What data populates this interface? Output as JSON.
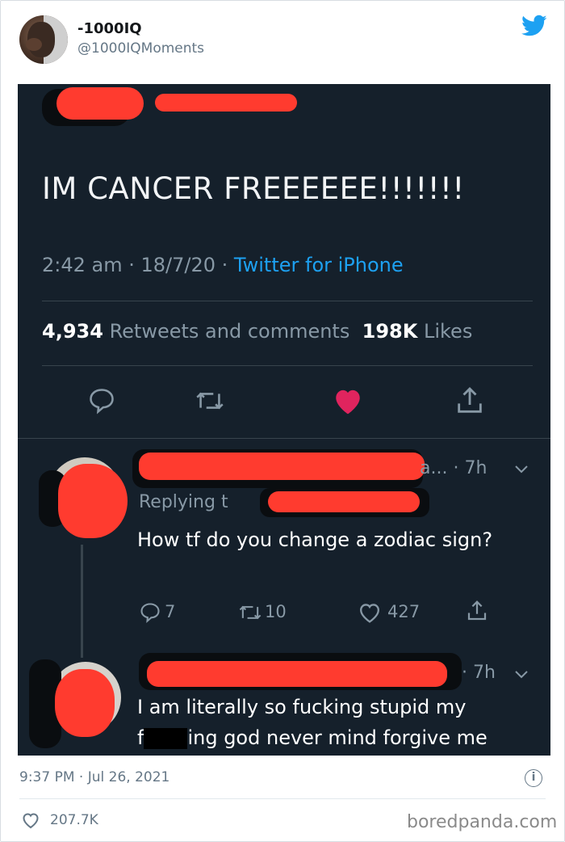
{
  "colors": {
    "twitter_blue": "#1da1f2",
    "like_pink": "#e0245e",
    "redaction": "#ff3b2f",
    "dark_bg": "#15202b"
  },
  "author": {
    "name": "-1000IQ",
    "handle": "@1000IQMoments"
  },
  "screenshot": {
    "main_tweet": {
      "text": "IM CANCER FREEEEEE!!!!!!!",
      "time": "2:42 am",
      "date": "18/7/20",
      "source": "Twitter for iPhone",
      "retweets": "4,934",
      "retweets_label": "Retweets and comments",
      "likes": "198K",
      "likes_label": "Likes",
      "actions": [
        "reply-icon",
        "retweet-icon",
        "like-icon-filled",
        "share-icon"
      ]
    },
    "reply1": {
      "time_suffix": "a... · 7h",
      "replying_to": "Replying t",
      "text": "How tf do you change a zodiac sign?",
      "replies": "7",
      "retweets": "10",
      "likes": "427"
    },
    "reply2": {
      "time_suffix": "· 7h",
      "text_line1": "I am literally so fucking stupid my",
      "text_line2_prefix": "f",
      "text_line2_rest": "ing god never mind forgive me"
    }
  },
  "footer": {
    "timestamp": "9:37 PM · Jul 26, 2021",
    "like_count": "207.7K",
    "watermark": "boredpanda.com"
  }
}
